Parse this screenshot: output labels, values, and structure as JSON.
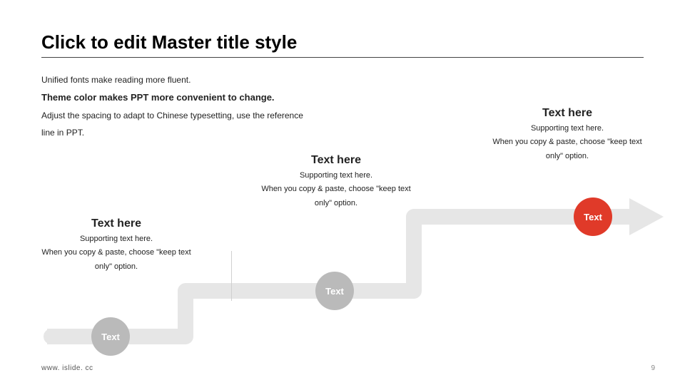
{
  "title": "Click to edit Master title style",
  "body": {
    "line1": "Unified fonts make reading more fluent.",
    "line2": "Theme color makes PPT more convenient to change.",
    "line3": "Adjust the spacing to adapt to Chinese typesetting, use the reference",
    "line4": "line in PPT."
  },
  "nodes": [
    {
      "label": "Text",
      "color": "grey"
    },
    {
      "label": "Text",
      "color": "grey"
    },
    {
      "label": "Text",
      "color": "red"
    }
  ],
  "blocks": [
    {
      "heading": "Text here",
      "support": "Supporting text here.",
      "copy1": "When you copy & paste, choose \"keep text",
      "copy2": "only\" option."
    },
    {
      "heading": "Text here",
      "support": "Supporting text here.",
      "copy1": "When you copy & paste, choose \"keep text",
      "copy2": "only\" option."
    },
    {
      "heading": "Text here",
      "support": "Supporting text here.",
      "copy1": "When you copy & paste, choose \"keep text",
      "copy2": "only\" option."
    }
  ],
  "footer": {
    "url": "www. islide. cc",
    "page": "9"
  },
  "colors": {
    "grey": "#bababa",
    "red": "#e03a29"
  }
}
